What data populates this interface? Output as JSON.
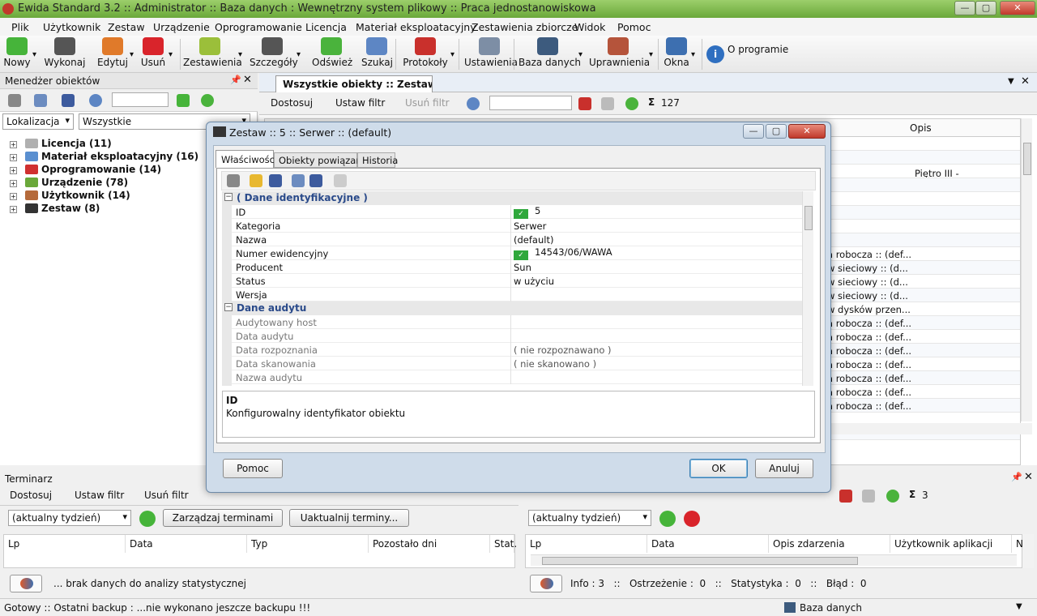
{
  "window": {
    "title": "Ewida Standard 3.2  ::  Administrator  ::  Baza danych : Wewnętrzny system plikowy  ::  Praca jednostanowiskowa",
    "min": "—",
    "max": "▢",
    "close": "✕"
  },
  "menu": [
    "Plik",
    "Użytkownik",
    "Zestaw",
    "Urządzenie",
    "Oprogramowanie",
    "Licencja",
    "Materiał eksploatacyjny",
    "Zestawienia zbiorcze",
    "Widok",
    "Pomoc"
  ],
  "toolbar": {
    "items": [
      {
        "label": "Nowy",
        "icon": "plus-icon",
        "color": "#46b43a"
      },
      {
        "label": "Wykonaj",
        "icon": "brush-icon",
        "color": "#555"
      },
      {
        "label": "Edytuj",
        "icon": "pencil-icon",
        "color": "#e07a2a"
      },
      {
        "label": "Usuń",
        "icon": "remove-icon",
        "color": "#d9242b"
      },
      {
        "label": "Zestawienia",
        "icon": "report-icon",
        "color": "#9bbf3a"
      },
      {
        "label": "Szczegóły",
        "icon": "details-icon",
        "color": "#555"
      },
      {
        "label": "Odśwież",
        "icon": "refresh-icon",
        "color": "#4ab33c"
      },
      {
        "label": "Szukaj",
        "icon": "search-icon",
        "color": "#5d86c4"
      },
      {
        "label": "Protokoły",
        "icon": "printer-icon",
        "color": "#c9302c"
      },
      {
        "label": "Ustawienia",
        "icon": "gear-icon",
        "color": "#7d8ea5"
      },
      {
        "label": "Baza danych",
        "icon": "database-icon",
        "color": "#3d5b7e"
      },
      {
        "label": "Uprawnienia",
        "icon": "user-key-icon",
        "color": "#b5543b"
      },
      {
        "label": "Okna",
        "icon": "windows-icon",
        "color": "#3d6fb0"
      }
    ],
    "about": "O programie"
  },
  "left_panel": {
    "title": "Menedżer obiektów",
    "combo1": "Lokalizacja",
    "combo2": "Wszystkie",
    "tree": [
      {
        "label": "Licencja (11)",
        "icon": "license-icon",
        "color": "#b0b0b0"
      },
      {
        "label": "Materiał eksploatacyjny (16)",
        "icon": "bottle-icon",
        "color": "#5a8fd0"
      },
      {
        "label": "Oprogramowanie (14)",
        "icon": "software-icon",
        "color": "#d03030"
      },
      {
        "label": "Urządzenie (78)",
        "icon": "device-icon",
        "color": "#6aa83a"
      },
      {
        "label": "Użytkownik (14)",
        "icon": "user-icon",
        "color": "#b56a3b"
      },
      {
        "label": "Zestaw (8)",
        "icon": "computer-icon",
        "color": "#333"
      }
    ]
  },
  "main": {
    "tab": "Wszystkie obiekty  ::  Zestawie...",
    "toolbar": {
      "customize": "Dostosuj",
      "set_filter": "Ustaw filtr",
      "remove_filter": "Usuń filtr",
      "count": "127"
    },
    "col_opis": "Opis",
    "row_opis": "Piętro III - serwerownia",
    "visible_rows": [
      "a robocza :: (def...",
      "w sieciowy :: (d...",
      "w sieciowy :: (d...",
      "w sieciowy :: (d...",
      "w dysków przen...",
      "a robocza :: (def...",
      "a robocza :: (def...",
      "a robocza :: (def...",
      "a robocza :: (def...",
      "a robocza :: (def...",
      "a robocza :: (def...",
      "a robocza :: (def..."
    ]
  },
  "dialog": {
    "title": "Zestaw :: 5 :: Serwer :: (default)",
    "tabs": [
      "Właściwości",
      "Obiekty powiązane",
      "Historia"
    ],
    "group1": "( Dane identyfikacyjne )",
    "props1": [
      {
        "k": "ID",
        "v": "5",
        "check": true
      },
      {
        "k": "Kategoria",
        "v": "Serwer"
      },
      {
        "k": "Nazwa",
        "v": "(default)"
      },
      {
        "k": "Numer ewidencyjny",
        "v": "14543/06/WAWA",
        "check": true
      },
      {
        "k": "Producent",
        "v": "Sun"
      },
      {
        "k": "Status",
        "v": "w użyciu"
      },
      {
        "k": "Wersja",
        "v": ""
      }
    ],
    "group2": "Dane audytu",
    "props2": [
      {
        "k": "Audytowany host",
        "v": ""
      },
      {
        "k": "Data audytu",
        "v": ""
      },
      {
        "k": "Data rozpoznania",
        "v": "( nie rozpoznawano )"
      },
      {
        "k": "Data skanowania",
        "v": "( nie skanowano )"
      },
      {
        "k": "Nazwa audytu",
        "v": ""
      }
    ],
    "desc_title": "ID",
    "desc_text": "Konfigurowalny identyfikator obiektu",
    "help": "Pomoc",
    "ok": "OK",
    "cancel": "Anuluj"
  },
  "terminarz": {
    "title": "Terminarz",
    "customize": "Dostosuj",
    "set_filter": "Ustaw filtr",
    "remove_filter": "Usuń filtr",
    "combo": "(aktualny tydzień)",
    "manage": "Zarządzaj terminami",
    "update": "Uaktualnij terminy...",
    "cols": [
      "Lp",
      "Data",
      "Typ",
      "Pozostało dni",
      "Stat."
    ],
    "stats": "... brak danych do analizy statystycznej"
  },
  "right_bottom": {
    "combo": "(aktualny tydzień)",
    "count": "3",
    "cols": [
      "Lp",
      "Data",
      "Opis zdarzenia",
      "Użytkownik aplikacji",
      "N"
    ],
    "info": "Info : 3   ::   Ostrzeżenie :  0   ::   Statystyka :  0   ::   Błąd :  0"
  },
  "status": {
    "text": "Gotowy  ::  Ostatni backup : ...nie wykonano jeszcze backupu !!!",
    "db": "Baza danych"
  }
}
